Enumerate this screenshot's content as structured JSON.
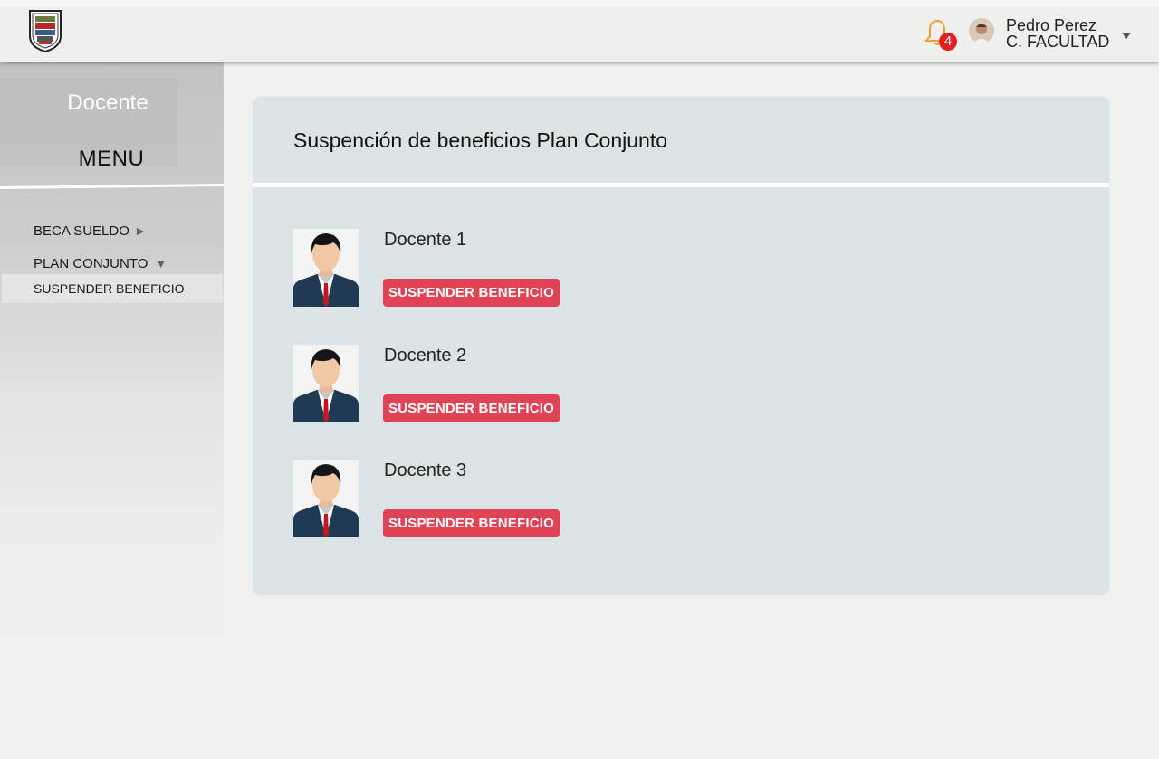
{
  "header": {
    "notifications_count": "4",
    "user_name": "Pedro Perez",
    "user_role": "C. FACULTAD",
    "icons": {
      "logo": "university-crest-logo",
      "notifications": "bell-icon",
      "avatar": "user-avatar",
      "menu": "caret-down-icon"
    },
    "colors": {
      "bell": "#f0a030",
      "badge": "#e02020"
    }
  },
  "sidebar": {
    "role": "Docente",
    "menu_title": "MENU",
    "items": [
      {
        "label": "BECA SUELDO",
        "arrow": "▶"
      },
      {
        "label": "PLAN CONJUNTO",
        "arrow": "▼"
      }
    ],
    "active_subitem": "SUSPENDER BENEFICIO"
  },
  "main": {
    "title": "Suspención de beneficios Plan Conjunto",
    "docentes": [
      {
        "name": "Docente 1",
        "action": "SUSPENDER BENEFICIO"
      },
      {
        "name": "Docente 2",
        "action": "SUSPENDER BENEFICIO"
      },
      {
        "name": "Docente 3",
        "action": "SUSPENDER BENEFICIO"
      }
    ],
    "colors": {
      "card": "#dce3e5",
      "button": "#e04355"
    }
  }
}
